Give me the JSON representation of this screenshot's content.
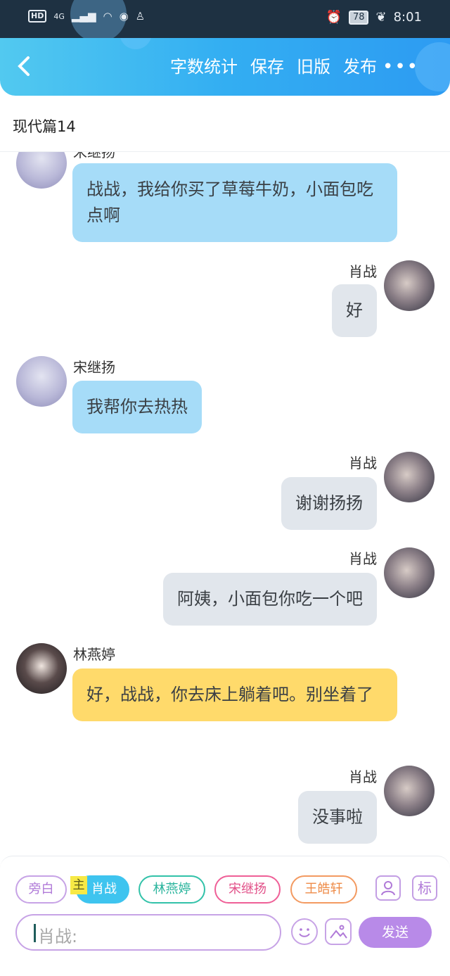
{
  "status_bar": {
    "hd": "HD",
    "network": "4G",
    "battery": "78",
    "time": "8:01"
  },
  "toolbar": {
    "word_count": "字数统计",
    "save": "保存",
    "old_version": "旧版",
    "publish": "发布",
    "more": "•••"
  },
  "chapter_title": "现代篇14",
  "messages": [
    {
      "speaker": "宋继扬",
      "side": "left",
      "color": "blue",
      "text": "战战，我给你买了草莓牛奶，小面包吃点啊"
    },
    {
      "speaker": "肖战",
      "side": "right",
      "color": "gray",
      "text": "好"
    },
    {
      "speaker": "宋继扬",
      "side": "left",
      "color": "blue",
      "text": "我帮你去热热"
    },
    {
      "speaker": "肖战",
      "side": "right",
      "color": "gray",
      "text": "谢谢扬扬"
    },
    {
      "speaker": "肖战",
      "side": "right",
      "color": "gray",
      "text": "阿姨，小面包你吃一个吧"
    },
    {
      "speaker": "林燕婷",
      "side": "left",
      "color": "yellow",
      "text": "好，战战，你去床上躺着吧。别坐着了"
    },
    {
      "speaker": "肖战",
      "side": "right",
      "color": "gray",
      "text": "没事啦"
    }
  ],
  "characters": {
    "narration": "旁白",
    "main_badge": "主",
    "xiao": "肖战",
    "lin": "林燕婷",
    "song": "宋继扬",
    "wang": "王皓轩",
    "tag_button": "标"
  },
  "composer": {
    "placeholder": "肖战:",
    "send": "发送"
  }
}
